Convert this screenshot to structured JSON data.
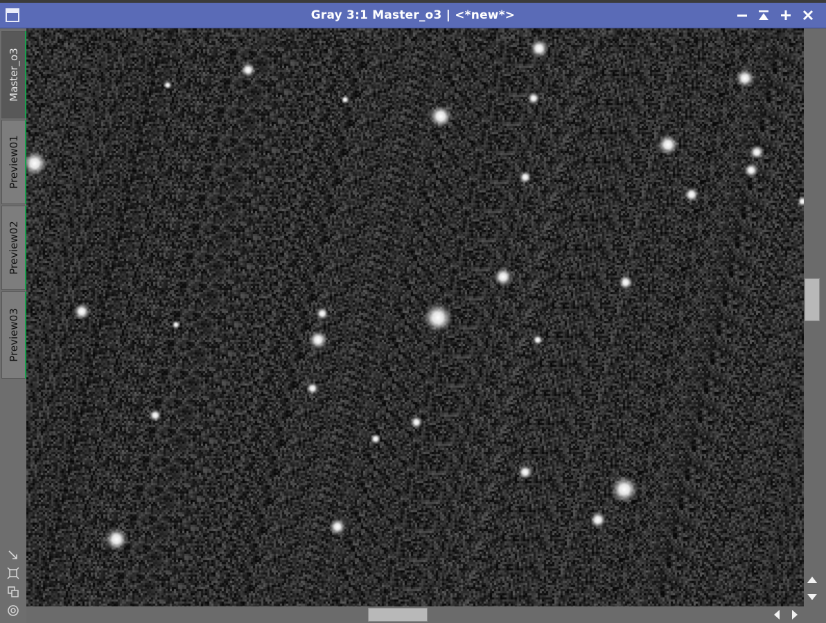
{
  "window": {
    "title": "Gray 3:1 Master_o3 | <*new*>",
    "title_bar_color": "#5a6bb7",
    "buttons": [
      "minimize-icon",
      "shade-icon",
      "maximize-icon",
      "close-icon"
    ]
  },
  "tabs": [
    {
      "label": "Master_o3",
      "active": true
    },
    {
      "label": "Preview01",
      "active": false
    },
    {
      "label": "Preview02",
      "active": false
    },
    {
      "label": "Preview03",
      "active": false
    }
  ],
  "tab_accent_color": "#19a04e",
  "tools": [
    "zoom-to-fit-icon",
    "fit-view-icon",
    "clone-view-icon",
    "target-icon"
  ],
  "image": {
    "kind": "grayscale star field"
  },
  "scrollbars": {
    "vertical": {
      "position": 0.46
    },
    "horizontal": {
      "position": 0.47
    }
  }
}
